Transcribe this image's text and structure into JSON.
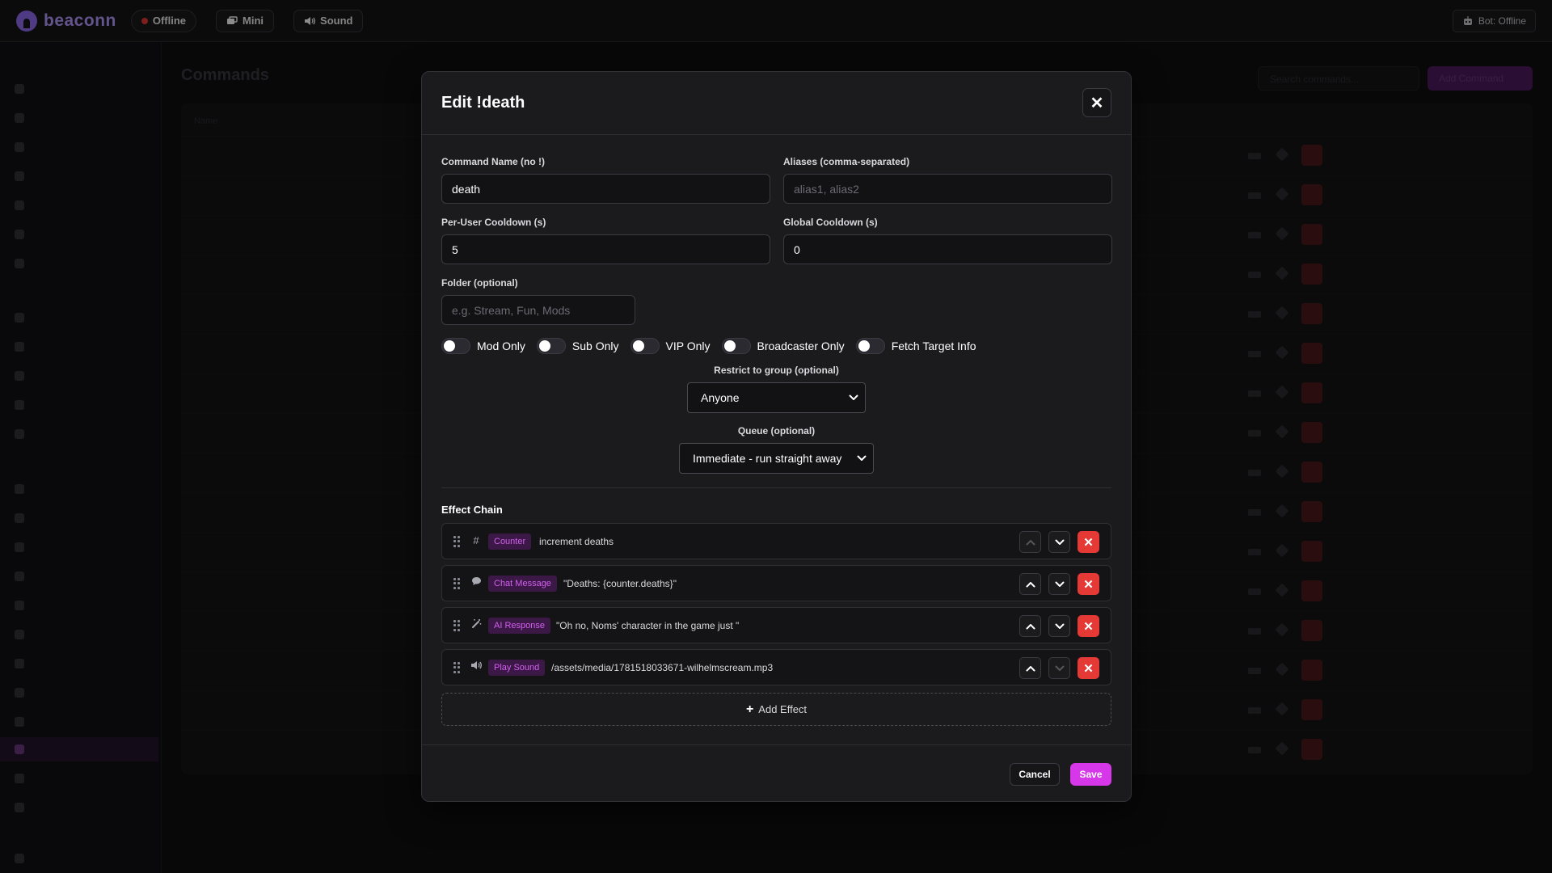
{
  "topbar": {
    "logo_text": "beaconn",
    "status_label": "Offline",
    "mini_label": "Mini",
    "sound_label": "Sound",
    "bot_status": "Bot: Offline"
  },
  "background": {
    "page_title": "Commands",
    "search_placeholder": "Search commands...",
    "add_button": "Add Command",
    "table_header": "Name"
  },
  "modal": {
    "title": "Edit !death",
    "command_name_label": "Command Name (no !)",
    "command_name_value": "death",
    "aliases_label": "Aliases (comma-separated)",
    "aliases_placeholder": "alias1, alias2",
    "per_user_cooldown_label": "Per-User Cooldown (s)",
    "per_user_cooldown_value": "5",
    "global_cooldown_label": "Global Cooldown (s)",
    "global_cooldown_value": "0",
    "folder_label": "Folder (optional)",
    "folder_placeholder": "e.g. Stream, Fun, Mods",
    "toggles": [
      {
        "label": "Mod Only",
        "on": false
      },
      {
        "label": "Sub Only",
        "on": false
      },
      {
        "label": "VIP Only",
        "on": false
      },
      {
        "label": "Broadcaster Only",
        "on": false
      },
      {
        "label": "Fetch Target Info",
        "on": false
      }
    ],
    "restrict_label": "Restrict to group (optional)",
    "restrict_value": "Anyone",
    "queue_label": "Queue (optional)",
    "queue_value": "Immediate - run straight away",
    "effect_chain_title": "Effect Chain",
    "effects": [
      {
        "icon": "hash-icon",
        "type": "Counter",
        "desc": "increment deaths"
      },
      {
        "icon": "chat-bubble-icon",
        "type": "Chat Message",
        "desc": "\"Deaths: {counter.deaths}\""
      },
      {
        "icon": "magic-wand-icon",
        "type": "AI Response",
        "desc": "\"Oh no, Noms' character in the game just \""
      },
      {
        "icon": "speaker-icon",
        "type": "Play Sound",
        "desc": "/assets/media/1781518033671-wilhelmscream.mp3"
      }
    ],
    "add_effect_label": "Add Effect",
    "cancel_label": "Cancel",
    "save_label": "Save"
  },
  "colors": {
    "accent": "#d637e8",
    "danger": "#e53935",
    "brand": "#b59bff"
  }
}
